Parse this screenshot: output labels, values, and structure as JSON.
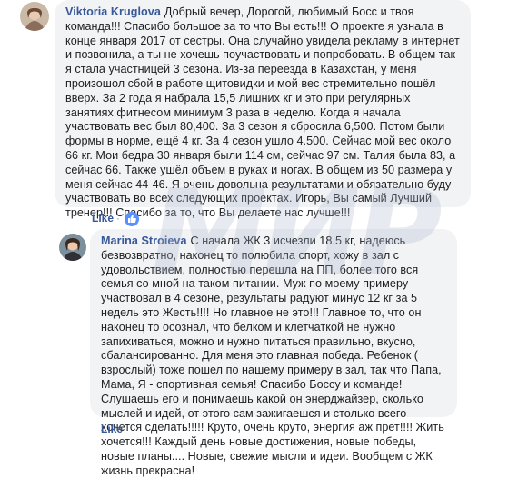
{
  "comments": [
    {
      "author": "Viktoria Kruglova",
      "text": "Добрый вечер, Дорогой, любимый Босс и твоя команда!!! Спасибо большое за то что Вы есть!!! О проекте я узнала в конце января 2017 от сестры. Она случайно увидела рекламу в интернет и позвонила, а ты не хочешь поучаствовать и попробовать. В общем так я стала участницей 3 сезона. Из-за переезда в Казахстан, у меня произошол сбой в работе щитовидки и мой вес стремительно пошёл вверх. За 2 года я набрала 15,5 лишних кг и это при регулярных занятиях фитнесом минимум 3 раза в неделю. Когда я начала участвовать вес был 80,400. За 3 сезон я сбросила 6,500. Потом были формы в норме, ещё 4 кг. За 4 сезон ушло 4.500. Сейчас мой вес около 66 кг. Мои бедра 30 января были 114 см, сейчас 97 см. Талия была 83, а сейчас 66. Также ушёл объем в руках и ногах. В общем из 50 размера у меня сейчас 44-46. Я очень довольна результатами и обязательно буду участвовать во всех следующих проектах. Игорь, Вы самый Лучший тренер!!! Спасибо за то, что Вы делаете нас лучше!!!",
      "like_label": "Like",
      "reaction_count": ""
    },
    {
      "author": "Marina Stroieva",
      "text": "С начала ЖК 3 исчезли 18.5 кг, надеюсь безвозвратно, наконец то полюбила спорт, хожу в зал с удовольствием, полностью перешла на ПП, более того вся семья со мной на таком питании. Муж по моему примеру участвовал в 4 сезоне, результаты радуют минус 12 кг за 5 недель это Жесть!!!! Но главное не это!!! Главное то, что он наконец то осознал, что белком и клетчаткой не нужно запихиваться, можно и нужно питаться правильно, вкусно, сбалансированно. Для меня это главная победа. Ребенок ( взрослый) тоже пошел по нашему примеру в зал, так что Папа, Мама, Я - спортивная семья! Спасибо Боссу и команде! Слушаешь его и понимаешь какой он энерджайзер, сколько мыслей и идей, от этого сам зажигаешся и столько всего хочется сделать!!!!! Круто, очень круто, энергия аж прет!!!! Жить хочется!!! Каждый день новые достижения, новые победы, новые планы.... Новые, свежие мысли и идеи. Вообщем с ЖК жизнь прекрасна!",
      "like_label": "Like",
      "reaction_count": ""
    }
  ],
  "watermark": "МИР",
  "colors": {
    "link": "#385898",
    "bubble": "#f2f3f5",
    "reaction": "#5890ff"
  },
  "icons": {
    "reaction": "thumbs-up-icon"
  }
}
